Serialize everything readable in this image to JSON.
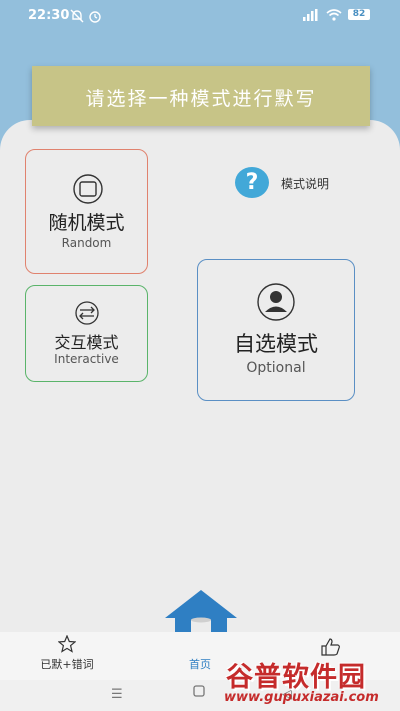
{
  "status_bar": {
    "time": "22:30",
    "battery": "82"
  },
  "banner": {
    "text": "请选择一种模式进行默写"
  },
  "help": {
    "label": "模式说明"
  },
  "modes": {
    "random": {
      "title": "随机模式",
      "subtitle": "Random"
    },
    "interactive": {
      "title": "交互模式",
      "subtitle": "Interactive"
    },
    "optional": {
      "title": "自选模式",
      "subtitle": "Optional"
    }
  },
  "bottom_nav": {
    "left_label": "已默+错词",
    "center_label": "首页"
  },
  "watermark": {
    "title": "谷普软件园",
    "url": "www.gupuxiazai.com"
  },
  "colors": {
    "accent_blue": "#93bfdc",
    "banner": "#c7c487",
    "random_border": "#e0826e",
    "interactive_border": "#5ab46a",
    "optional_border": "#5a8fc4",
    "help_icon": "#42a8d8",
    "home_icon": "#2f7fc3",
    "watermark": "#c52b2b"
  }
}
